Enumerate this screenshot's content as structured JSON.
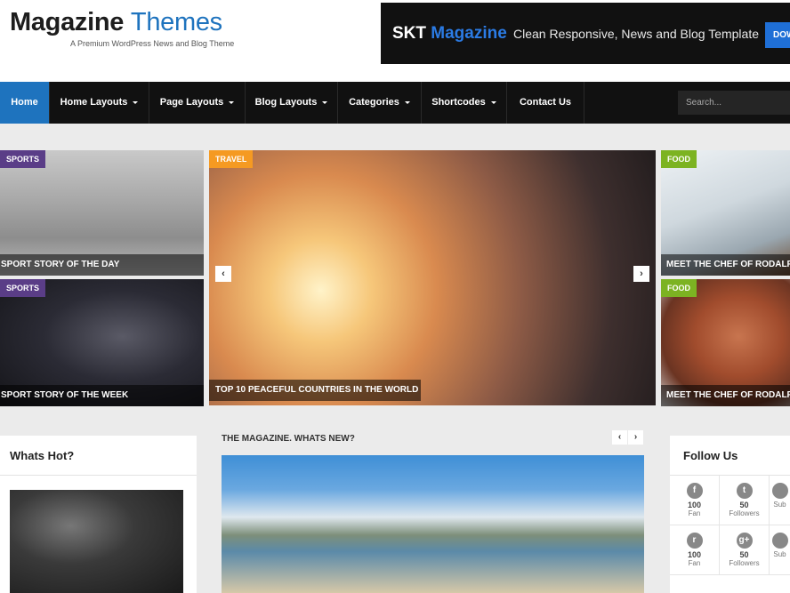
{
  "header": {
    "logo_part1": "Magazine",
    "logo_part2": "Themes",
    "tagline": "A Premium WordPress News and Blog Theme",
    "banner_brand_1": "SKT",
    "banner_brand_2": "Magazine",
    "banner_desc": "Clean Responsive, News and Blog Template",
    "banner_button": "DOW"
  },
  "nav": {
    "items": [
      {
        "label": "Home"
      },
      {
        "label": "Home Layouts"
      },
      {
        "label": "Page Layouts"
      },
      {
        "label": "Blog Layouts"
      },
      {
        "label": "Categories"
      },
      {
        "label": "Shortcodes"
      },
      {
        "label": "Contact Us"
      }
    ],
    "search_placeholder": "Search..."
  },
  "tiles": {
    "skate": {
      "category": "SPORTS",
      "caption": "SPORT STORY OF THE DAY"
    },
    "basket": {
      "category": "SPORTS",
      "caption": "SPORT STORY OF THE WEEK"
    },
    "travel": {
      "category": "TRAVEL",
      "caption": "TOP 10 PEACEFUL COUNTRIES IN THE WORLD"
    },
    "food1": {
      "category": "FOOD",
      "caption": "MEET THE CHEF OF RODALF"
    },
    "food2": {
      "category": "FOOD",
      "caption": "MEET THE CHEF OF RODALF"
    }
  },
  "slider": {
    "prev": "‹",
    "next": "›"
  },
  "whats_hot": {
    "title": "Whats Hot?"
  },
  "magazine": {
    "title": "THE MAGAZINE. WHATS NEW?",
    "prev": "‹",
    "next": "›"
  },
  "follow": {
    "title": "Follow Us",
    "items": [
      {
        "icon": "f",
        "count": "100",
        "label": "Fan"
      },
      {
        "icon": "t",
        "count": "50",
        "label": "Followers"
      },
      {
        "icon": "",
        "count": "",
        "label": "Sub"
      },
      {
        "icon": "r",
        "count": "100",
        "label": "Fan"
      },
      {
        "icon": "g+",
        "count": "50",
        "label": "Followers"
      },
      {
        "icon": "",
        "count": "",
        "label": "Sub"
      }
    ]
  },
  "colors": {
    "accent": "#1e73be",
    "sports": "#5a3d87",
    "travel": "#f59a22",
    "food": "#7cb322"
  }
}
